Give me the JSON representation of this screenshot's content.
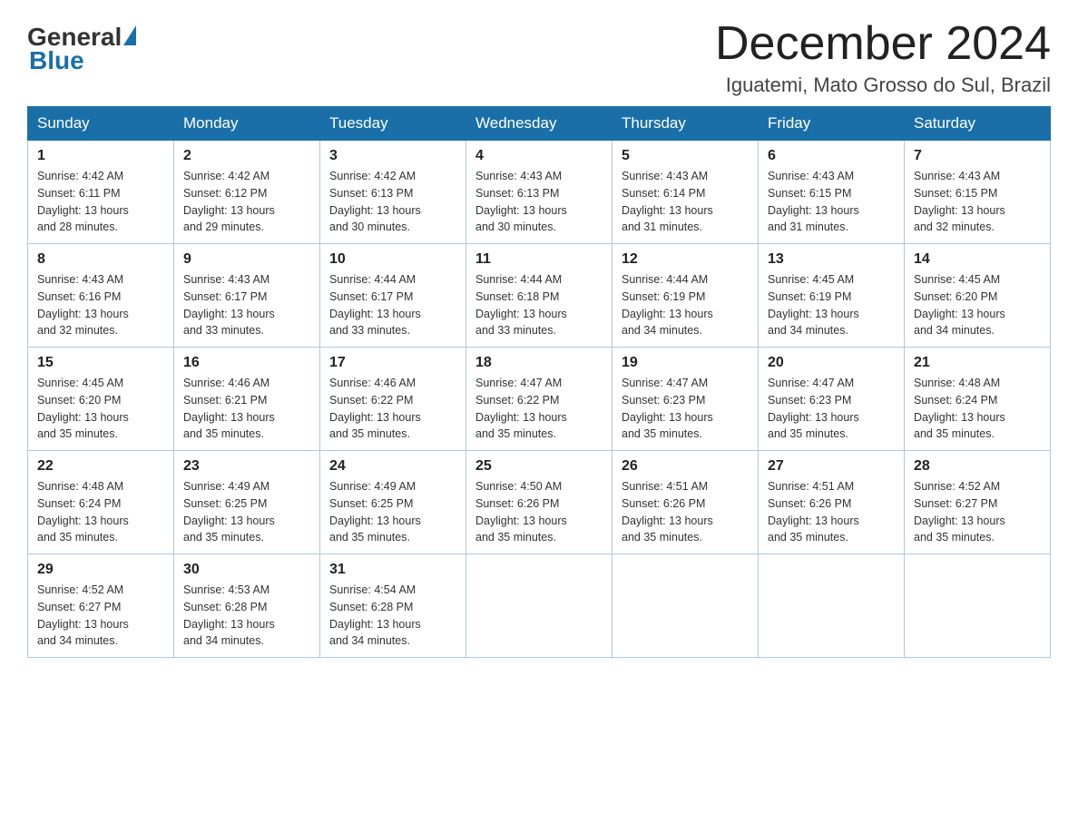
{
  "header": {
    "logo_general": "General",
    "logo_blue": "Blue",
    "month_title": "December 2024",
    "location": "Iguatemi, Mato Grosso do Sul, Brazil"
  },
  "weekdays": [
    "Sunday",
    "Monday",
    "Tuesday",
    "Wednesday",
    "Thursday",
    "Friday",
    "Saturday"
  ],
  "weeks": [
    [
      {
        "day": "1",
        "sunrise": "4:42 AM",
        "sunset": "6:11 PM",
        "daylight": "13 hours and 28 minutes."
      },
      {
        "day": "2",
        "sunrise": "4:42 AM",
        "sunset": "6:12 PM",
        "daylight": "13 hours and 29 minutes."
      },
      {
        "day": "3",
        "sunrise": "4:42 AM",
        "sunset": "6:13 PM",
        "daylight": "13 hours and 30 minutes."
      },
      {
        "day": "4",
        "sunrise": "4:43 AM",
        "sunset": "6:13 PM",
        "daylight": "13 hours and 30 minutes."
      },
      {
        "day": "5",
        "sunrise": "4:43 AM",
        "sunset": "6:14 PM",
        "daylight": "13 hours and 31 minutes."
      },
      {
        "day": "6",
        "sunrise": "4:43 AM",
        "sunset": "6:15 PM",
        "daylight": "13 hours and 31 minutes."
      },
      {
        "day": "7",
        "sunrise": "4:43 AM",
        "sunset": "6:15 PM",
        "daylight": "13 hours and 32 minutes."
      }
    ],
    [
      {
        "day": "8",
        "sunrise": "4:43 AM",
        "sunset": "6:16 PM",
        "daylight": "13 hours and 32 minutes."
      },
      {
        "day": "9",
        "sunrise": "4:43 AM",
        "sunset": "6:17 PM",
        "daylight": "13 hours and 33 minutes."
      },
      {
        "day": "10",
        "sunrise": "4:44 AM",
        "sunset": "6:17 PM",
        "daylight": "13 hours and 33 minutes."
      },
      {
        "day": "11",
        "sunrise": "4:44 AM",
        "sunset": "6:18 PM",
        "daylight": "13 hours and 33 minutes."
      },
      {
        "day": "12",
        "sunrise": "4:44 AM",
        "sunset": "6:19 PM",
        "daylight": "13 hours and 34 minutes."
      },
      {
        "day": "13",
        "sunrise": "4:45 AM",
        "sunset": "6:19 PM",
        "daylight": "13 hours and 34 minutes."
      },
      {
        "day": "14",
        "sunrise": "4:45 AM",
        "sunset": "6:20 PM",
        "daylight": "13 hours and 34 minutes."
      }
    ],
    [
      {
        "day": "15",
        "sunrise": "4:45 AM",
        "sunset": "6:20 PM",
        "daylight": "13 hours and 35 minutes."
      },
      {
        "day": "16",
        "sunrise": "4:46 AM",
        "sunset": "6:21 PM",
        "daylight": "13 hours and 35 minutes."
      },
      {
        "day": "17",
        "sunrise": "4:46 AM",
        "sunset": "6:22 PM",
        "daylight": "13 hours and 35 minutes."
      },
      {
        "day": "18",
        "sunrise": "4:47 AM",
        "sunset": "6:22 PM",
        "daylight": "13 hours and 35 minutes."
      },
      {
        "day": "19",
        "sunrise": "4:47 AM",
        "sunset": "6:23 PM",
        "daylight": "13 hours and 35 minutes."
      },
      {
        "day": "20",
        "sunrise": "4:47 AM",
        "sunset": "6:23 PM",
        "daylight": "13 hours and 35 minutes."
      },
      {
        "day": "21",
        "sunrise": "4:48 AM",
        "sunset": "6:24 PM",
        "daylight": "13 hours and 35 minutes."
      }
    ],
    [
      {
        "day": "22",
        "sunrise": "4:48 AM",
        "sunset": "6:24 PM",
        "daylight": "13 hours and 35 minutes."
      },
      {
        "day": "23",
        "sunrise": "4:49 AM",
        "sunset": "6:25 PM",
        "daylight": "13 hours and 35 minutes."
      },
      {
        "day": "24",
        "sunrise": "4:49 AM",
        "sunset": "6:25 PM",
        "daylight": "13 hours and 35 minutes."
      },
      {
        "day": "25",
        "sunrise": "4:50 AM",
        "sunset": "6:26 PM",
        "daylight": "13 hours and 35 minutes."
      },
      {
        "day": "26",
        "sunrise": "4:51 AM",
        "sunset": "6:26 PM",
        "daylight": "13 hours and 35 minutes."
      },
      {
        "day": "27",
        "sunrise": "4:51 AM",
        "sunset": "6:26 PM",
        "daylight": "13 hours and 35 minutes."
      },
      {
        "day": "28",
        "sunrise": "4:52 AM",
        "sunset": "6:27 PM",
        "daylight": "13 hours and 35 minutes."
      }
    ],
    [
      {
        "day": "29",
        "sunrise": "4:52 AM",
        "sunset": "6:27 PM",
        "daylight": "13 hours and 34 minutes."
      },
      {
        "day": "30",
        "sunrise": "4:53 AM",
        "sunset": "6:28 PM",
        "daylight": "13 hours and 34 minutes."
      },
      {
        "day": "31",
        "sunrise": "4:54 AM",
        "sunset": "6:28 PM",
        "daylight": "13 hours and 34 minutes."
      },
      null,
      null,
      null,
      null
    ]
  ],
  "labels": {
    "sunrise": "Sunrise:",
    "sunset": "Sunset:",
    "daylight": "Daylight:"
  }
}
